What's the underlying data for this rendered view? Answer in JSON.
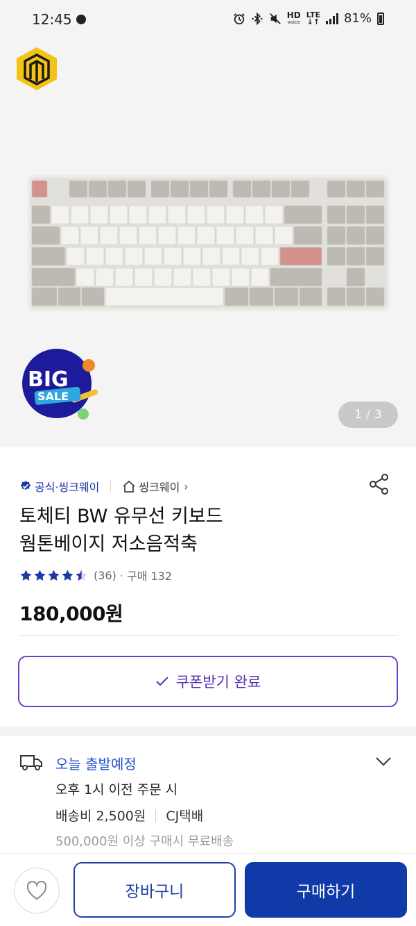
{
  "status_bar": {
    "time": "12:45",
    "hd_label": "HD",
    "voice_label": "voice",
    "lte_label": "LTE",
    "battery": "81%"
  },
  "gallery": {
    "badge_text_1": "BIG",
    "badge_text_2": "SALE",
    "current_page": "1",
    "separator": "/",
    "total_pages": "3",
    "brand_colors": {
      "logo_yellow": "#f3c315",
      "logo_dark": "#1a1a1a",
      "badge_navy": "#1d1a9c"
    }
  },
  "product": {
    "official_label": "공식·씽크웨이",
    "store_name": "씽크웨이",
    "store_chevron": "›",
    "title_line1": "토체티 BW 유무선 키보드",
    "title_line2": "웜톤베이지 저소음적축",
    "rating": 4.5,
    "review_count": "(36)",
    "sep_dot": "·",
    "purchase_count": "구매 132",
    "price": "180,000원",
    "coupon_label": "쿠폰받기 완료",
    "accent_color": "#5a2fb4"
  },
  "shipping": {
    "title": "오늘 출발예정",
    "cutoff": "오후 1시 이전 주문 시",
    "fee": "배송비 2,500원",
    "carrier": "CJ택배",
    "free_condition": "500,000원 이상 구매시 무료배송",
    "title_color": "#1f4fcc"
  },
  "bottom_bar": {
    "cart_label": "장바구니",
    "buy_label": "구매하기",
    "primary_color": "#0f3aa8"
  }
}
